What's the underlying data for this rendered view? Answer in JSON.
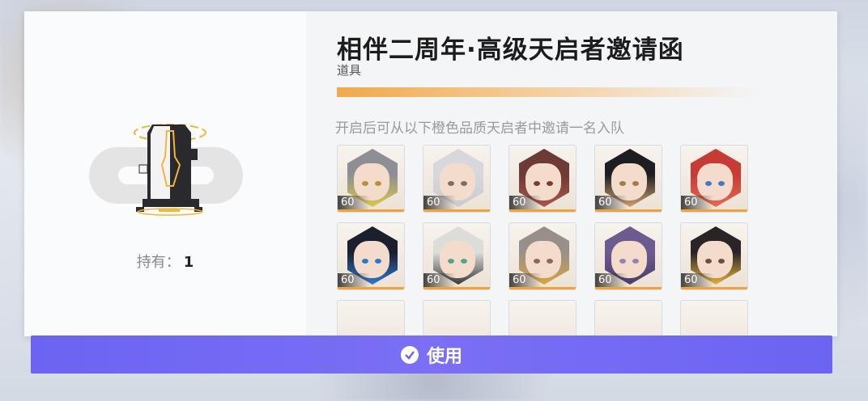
{
  "item": {
    "title": "相伴二周年·高级天启者邀请函",
    "type": "道具",
    "owned_label": "持有：",
    "owned_count": "1"
  },
  "description": "开启后可从以下橙色品质天启者中邀请一名入队",
  "characters": [
    {
      "level": "60",
      "hair": "#8e8e95",
      "accent": "#d9c84a",
      "eye": "#b9922e"
    },
    {
      "level": "60",
      "hair": "#d8d8dc",
      "accent": "#c9c9cf",
      "eye": "#7a6f66"
    },
    {
      "level": "60",
      "hair": "#6e3a36",
      "accent": "#a9564b",
      "eye": "#7b3d2d"
    },
    {
      "level": "60",
      "hair": "#1e1e22",
      "accent": "#caa06e",
      "eye": "#a07c48"
    },
    {
      "level": "60",
      "hair": "#c83a34",
      "accent": "#e36a55",
      "eye": "#3e78c9"
    },
    {
      "level": "60",
      "hair": "#1b1f2e",
      "accent": "#2b79d1",
      "eye": "#2b79d1"
    },
    {
      "level": "60",
      "hair": "#dcdcd8",
      "accent": "#3a3a3a",
      "eye": "#4fa58e"
    },
    {
      "level": "60",
      "hair": "#9a8f88",
      "accent": "#d7a442",
      "eye": "#8b6a5a"
    },
    {
      "level": "60",
      "hair": "#6d5b8f",
      "accent": "#4a3e66",
      "eye": "#9a7fb7"
    },
    {
      "level": "60",
      "hair": "#2a2427",
      "accent": "#e2b13a",
      "eye": "#6c4f43"
    }
  ],
  "use_button": {
    "label": "使用",
    "icon": "check-circle-icon"
  },
  "colors": {
    "accent_orange": "#f0a23c",
    "button_purple": "#6c63f2"
  }
}
